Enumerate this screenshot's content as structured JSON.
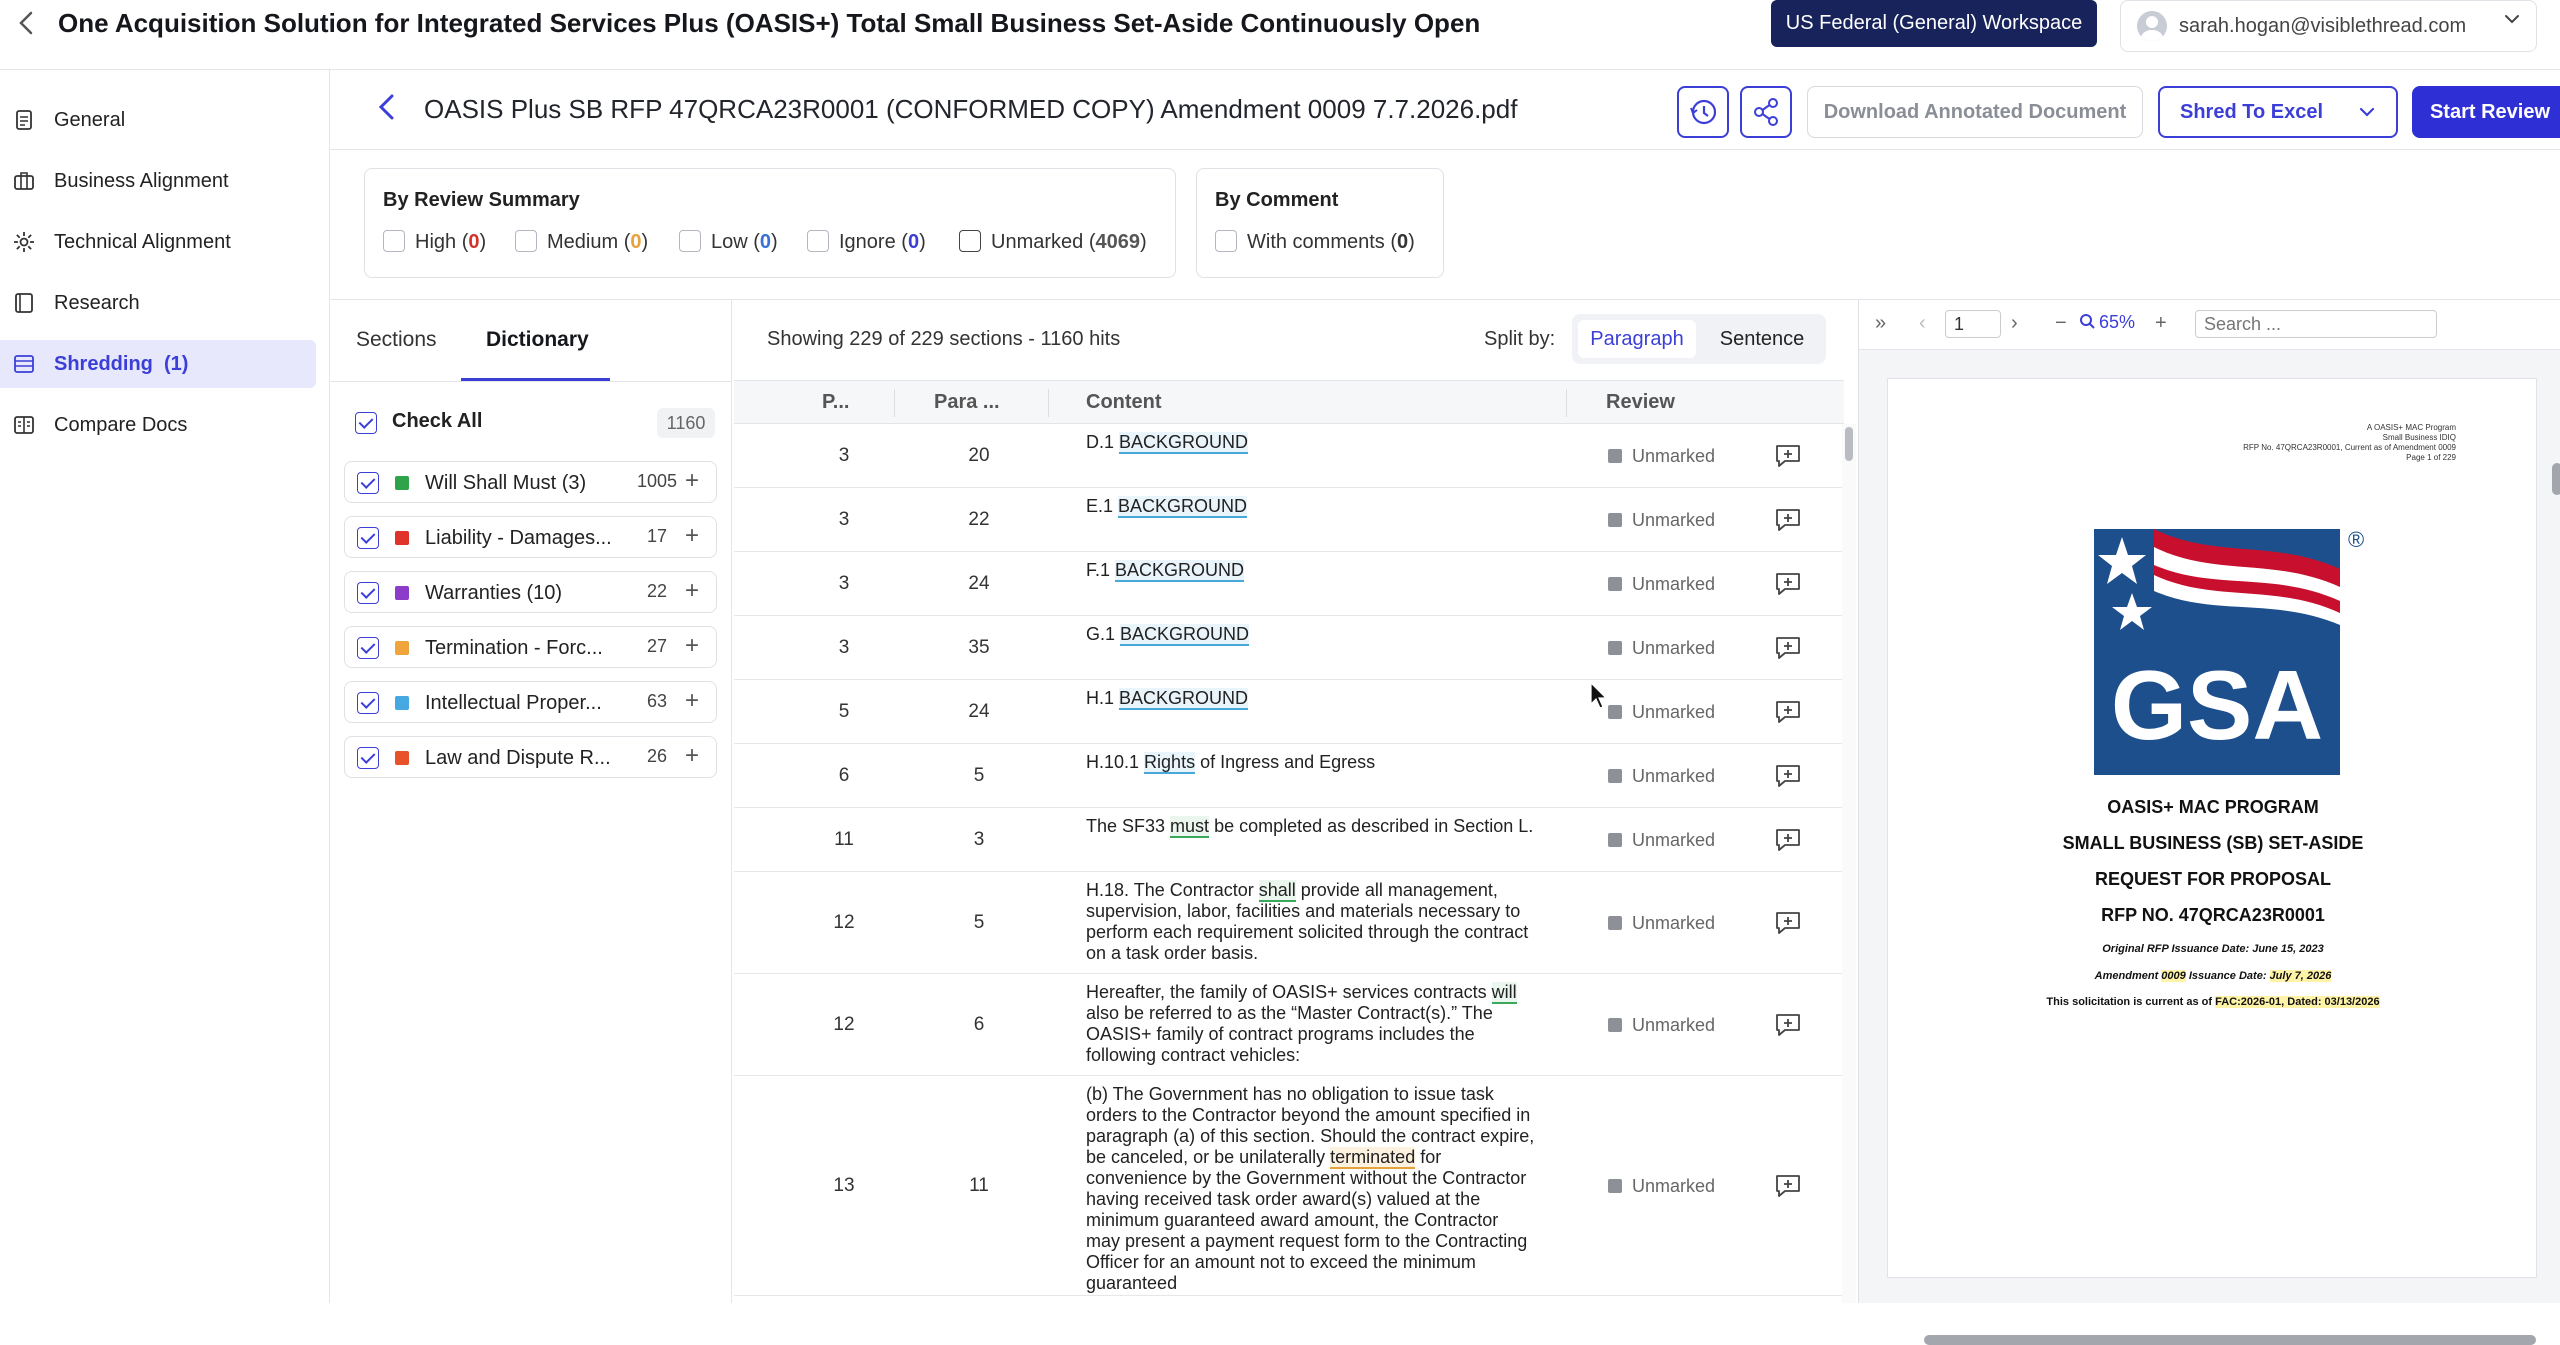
{
  "app": {
    "title": "One Acquisition Solution for Integrated Services Plus (OASIS+) Total Small Business Set-Aside Continuously Open",
    "workspace": "US Federal (General) Workspace",
    "user_email": "sarah.hogan@visiblethread.com"
  },
  "sidebar": {
    "items": [
      {
        "label": "General",
        "icon": "document-icon",
        "active": false
      },
      {
        "label": "Business Alignment",
        "icon": "briefcase-icon",
        "active": false
      },
      {
        "label": "Technical Alignment",
        "icon": "gear-icon",
        "active": false
      },
      {
        "label": "Research",
        "icon": "book-icon",
        "active": false
      },
      {
        "label": "Shredding  (1)",
        "icon": "list-icon",
        "active": true
      },
      {
        "label": "Compare Docs",
        "icon": "compare-icon",
        "active": false
      }
    ]
  },
  "document": {
    "title": "OASIS Plus SB RFP 47QRCA23R0001 (CONFORMED COPY) Amendment 0009 7.7.2026.pdf",
    "download_label": "Download Annotated Document",
    "shred_label": "Shred To Excel",
    "start_review_label": "Start Review"
  },
  "filters": {
    "review_summary_title": "By Review Summary",
    "review_options": [
      {
        "label": "High (",
        "count": "0",
        "close": ")",
        "color": "#d0342c"
      },
      {
        "label": "Medium (",
        "count": "0",
        "close": ")",
        "color": "#e8a23b"
      },
      {
        "label": "Low (",
        "count": "0",
        "close": ")",
        "color": "#3b6fd8"
      },
      {
        "label": "Ignore (",
        "count": "0",
        "close": ")",
        "color": "#3b3fd8"
      },
      {
        "label": "Unmarked (",
        "count": "4069",
        "close": ")",
        "color": "#555555"
      }
    ],
    "comment_title": "By Comment",
    "comment_label": "With comments (",
    "comment_count": "0",
    "comment_close": ")"
  },
  "left_panel": {
    "tabs": [
      "Sections",
      "Dictionary"
    ],
    "active_tab": "Dictionary",
    "check_all_label": "Check All",
    "check_all_count": "1160",
    "dictionary": [
      {
        "name": "Will Shall Must (3)",
        "count": "1005",
        "color": "#2fa34a"
      },
      {
        "name": "Liability - Damages...",
        "count": "17",
        "color": "#e0332c"
      },
      {
        "name": "Warranties (10)",
        "count": "22",
        "color": "#8b3cc8"
      },
      {
        "name": "Termination - Forc...",
        "count": "27",
        "color": "#f0a53a"
      },
      {
        "name": "Intellectual Proper...",
        "count": "63",
        "color": "#46a8e0"
      },
      {
        "name": "Law and Dispute R...",
        "count": "26",
        "color": "#e8522a"
      }
    ]
  },
  "center": {
    "showing": "Showing 229 of 229 sections - 1160 hits",
    "split_by_label": "Split by:",
    "split_options": [
      "Paragraph",
      "Sentence"
    ],
    "columns": [
      "P...",
      "Para ...",
      "Content",
      "Review"
    ],
    "rows": [
      {
        "page": "3",
        "para": "20",
        "segments": [
          {
            "t": "D.1 "
          },
          {
            "t": "BACKGROUND",
            "h": "blue"
          }
        ],
        "review": "Unmarked"
      },
      {
        "page": "3",
        "para": "22",
        "segments": [
          {
            "t": "E.1 "
          },
          {
            "t": "BACKGROUND",
            "h": "blue"
          }
        ],
        "review": "Unmarked"
      },
      {
        "page": "3",
        "para": "24",
        "segments": [
          {
            "t": "F.1 "
          },
          {
            "t": "BACKGROUND",
            "h": "blue"
          }
        ],
        "review": "Unmarked"
      },
      {
        "page": "3",
        "para": "35",
        "segments": [
          {
            "t": "G.1 "
          },
          {
            "t": "BACKGROUND",
            "h": "blue"
          }
        ],
        "review": "Unmarked"
      },
      {
        "page": "5",
        "para": "24",
        "segments": [
          {
            "t": "H.1 "
          },
          {
            "t": "BACKGROUND",
            "h": "blue"
          }
        ],
        "review": "Unmarked"
      },
      {
        "page": "6",
        "para": "5",
        "segments": [
          {
            "t": "H.10.1 "
          },
          {
            "t": "Rights",
            "h": "blue"
          },
          {
            "t": " of Ingress and Egress"
          }
        ],
        "review": "Unmarked"
      },
      {
        "page": "11",
        "para": "3",
        "segments": [
          {
            "t": "The SF33 "
          },
          {
            "t": "must",
            "h": "green"
          },
          {
            "t": " be completed as described in Section L."
          }
        ],
        "review": "Unmarked"
      },
      {
        "page": "12",
        "para": "5",
        "segments": [
          {
            "t": "H.18. The Contractor "
          },
          {
            "t": "shall",
            "h": "green"
          },
          {
            "t": " provide all management, supervision, labor, facilities and materials necessary to perform each requirement solicited through the contract on a task order basis."
          }
        ],
        "review": "Unmarked"
      },
      {
        "page": "12",
        "para": "6",
        "segments": [
          {
            "t": "Hereafter, the family of OASIS+ services contracts "
          },
          {
            "t": "will",
            "h": "green"
          },
          {
            "t": " also be referred to as the “Master Contract(s).” The OASIS+ family of contract programs includes the following contract vehicles:"
          }
        ],
        "review": "Unmarked"
      },
      {
        "page": "13",
        "para": "11",
        "segments": [
          {
            "t": "(b) The Government has no obligation to issue task orders to the Contractor beyond the amount specified in paragraph (a) of this section. Should the contract expire, be canceled, or be unilaterally "
          },
          {
            "t": "terminated",
            "h": "orange"
          },
          {
            "t": " for convenience by the Government without the Contractor having received task order award(s) valued at the minimum guaranteed award amount, the Contractor may present a payment request form to the Contracting Officer for an amount not to exceed the minimum guaranteed"
          }
        ],
        "review": "Unmarked"
      }
    ]
  },
  "pdf": {
    "page_number": "1",
    "zoom": "65%",
    "search_placeholder": "Search ...",
    "header_lines": [
      "A OASIS+ MAC Program",
      "Small Business IDIQ",
      "RFP No. 47QRCA23R0001, Current as of Amendment 0009",
      "Page 1 of 229"
    ],
    "logo_text": "GSA",
    "title_lines": [
      "OASIS+ MAC PROGRAM",
      "SMALL BUSINESS (SB) SET-ASIDE",
      "REQUEST FOR PROPOSAL",
      "RFP NO. 47QRCA23R0001"
    ],
    "issuance": "Original RFP Issuance Date: June 15, 2023",
    "amendment_pre": "Amendment ",
    "amendment_num": "0009",
    "amendment_mid": " Issuance Date: ",
    "amendment_date": "July 7, 2026",
    "current_pre": "This solicitation is current as of ",
    "current_val": "FAC:2026-01, Dated: 03/13/2026"
  }
}
